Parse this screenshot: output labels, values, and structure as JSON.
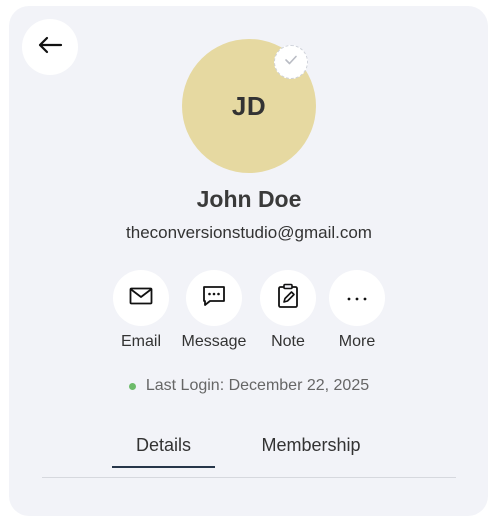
{
  "profile": {
    "initials": "JD",
    "name": "John Doe",
    "email": "theconversionstudio@gmail.com",
    "avatar_color": "#e6d9a1"
  },
  "actions": [
    {
      "label": "Email",
      "icon": "envelope-icon"
    },
    {
      "label": "Message",
      "icon": "chat-bubble-icon"
    },
    {
      "label": "Note",
      "icon": "note-edit-icon"
    },
    {
      "label": "More",
      "icon": "more-horizontal-icon"
    }
  ],
  "status": {
    "last_login_text": "Last Login: December 22, 2025",
    "dot_color": "#6dbb6a"
  },
  "tabs": [
    {
      "label": "Details",
      "active": true
    },
    {
      "label": "Membership",
      "active": false
    }
  ]
}
